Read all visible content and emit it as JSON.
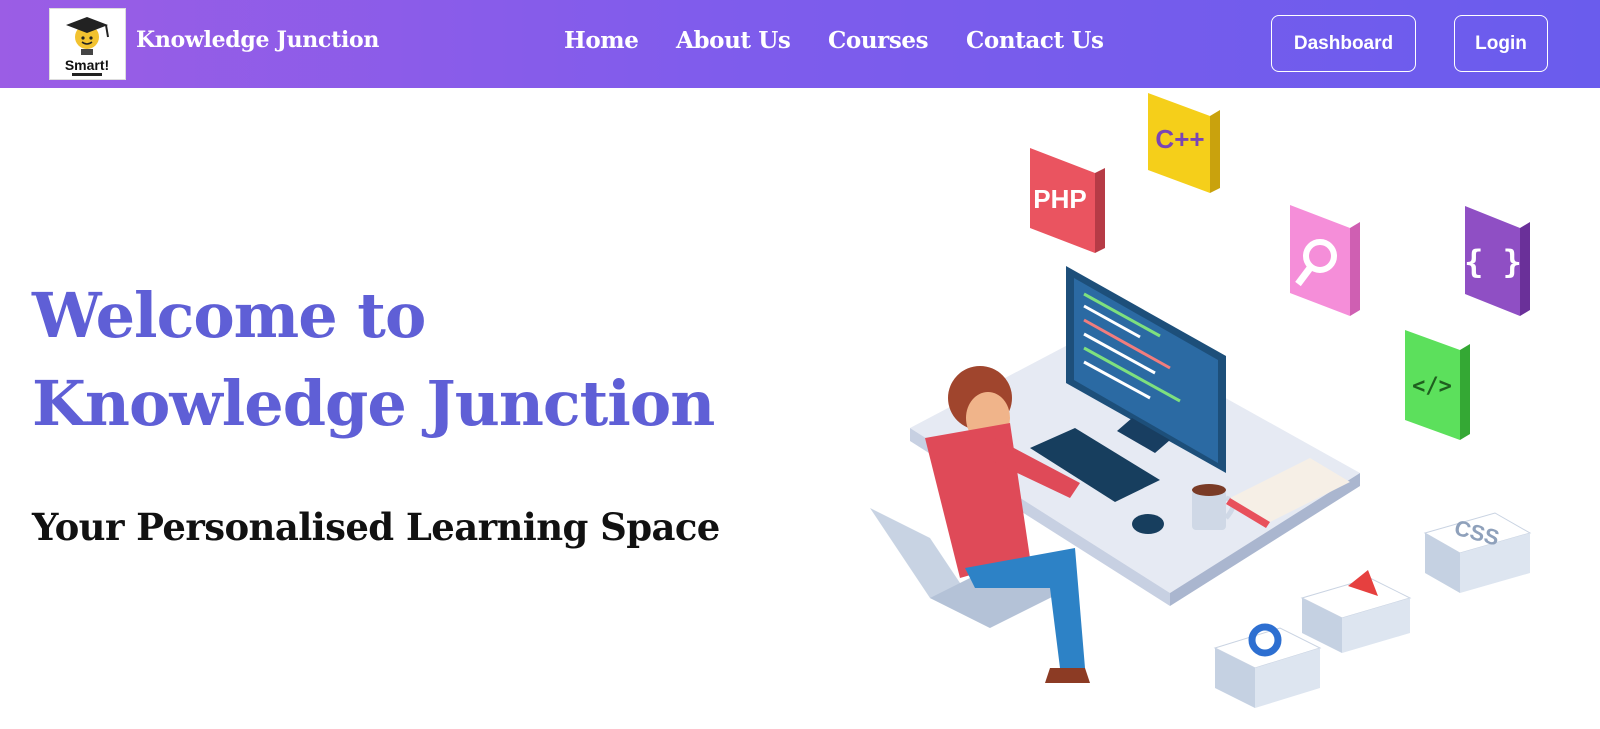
{
  "header": {
    "logo_text": "Smart!",
    "brand": "Knowledge Junction",
    "nav": [
      {
        "label": "Home"
      },
      {
        "label": "About Us"
      },
      {
        "label": "Courses"
      },
      {
        "label": "Contact Us"
      }
    ],
    "dashboard_label": "Dashboard",
    "login_label": "Login"
  },
  "hero": {
    "title_line1": "Welcome to",
    "title_line2": "Knowledge Junction",
    "subtitle": "Your Personalised Learning Space"
  },
  "illustration": {
    "badges": [
      "PHP",
      "C++",
      "{ }",
      "</>",
      "CSS"
    ]
  },
  "colors": {
    "nav_gradient_start": "#9b5de5",
    "nav_gradient_end": "#6a5ced",
    "hero_title": "#5f5fd6"
  }
}
